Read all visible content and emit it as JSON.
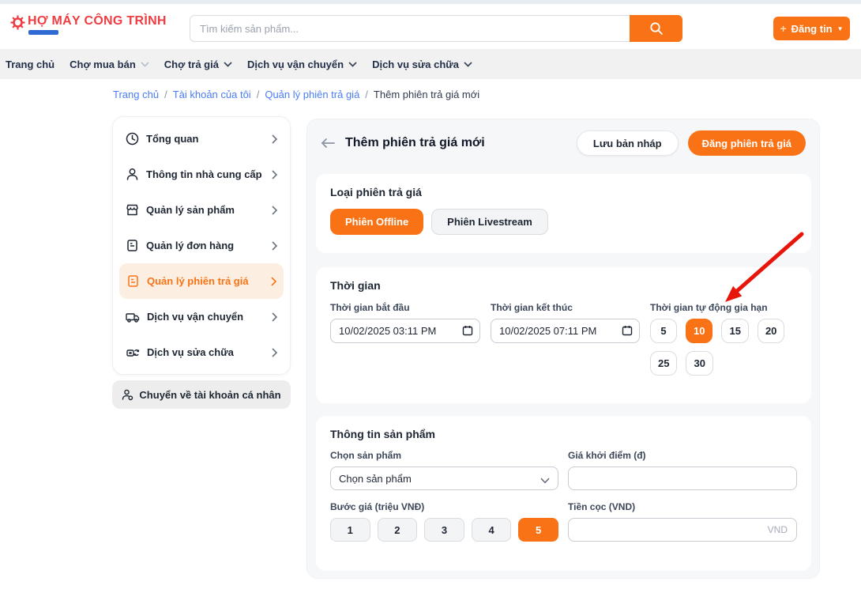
{
  "accent_color": "#f97316",
  "header": {
    "logo_text": "HỢ MÁY CÔNG TRÌNH",
    "search_placeholder": "Tìm kiếm sản phẩm...",
    "post_button_label": "Đăng tin",
    "post_button_plus": "+",
    "post_button_caret": "▼"
  },
  "nav": {
    "items": [
      {
        "label": "Trang chủ"
      },
      {
        "label": "Chợ mua bán"
      },
      {
        "label": "Chợ trả giá"
      },
      {
        "label": "Dịch vụ vận chuyển"
      },
      {
        "label": "Dịch vụ sửa chữa"
      }
    ]
  },
  "breadcrumb": {
    "separator": "/",
    "links": [
      "Trang chủ",
      "Tài khoản của tôi",
      "Quản lý phiên trả giá"
    ],
    "current": "Thêm phiên trả giá mới"
  },
  "sidebar": {
    "items": [
      {
        "icon": "clock-icon",
        "label": "Tổng quan"
      },
      {
        "icon": "user-icon",
        "label": "Thông tin nhà cung cấp"
      },
      {
        "icon": "store-icon",
        "label": "Quản lý sản phẩm"
      },
      {
        "icon": "order-icon",
        "label": "Quản lý đơn hàng"
      },
      {
        "icon": "auction-icon",
        "label": "Quản lý phiên trả giá"
      },
      {
        "icon": "truck-icon",
        "label": "Dịch vụ vận chuyển"
      },
      {
        "icon": "repair-icon",
        "label": "Dịch vụ sửa chữa"
      }
    ],
    "active_item": "Quản lý phiên trả giá",
    "switch_account_label": "Chuyển về tài khoản cá nhân"
  },
  "main": {
    "title": "Thêm phiên trả giá mới",
    "draft_button": "Lưu bản nháp",
    "publish_button": "Đăng phiên trả giá",
    "session_type": {
      "title": "Loại phiên trả giá",
      "offline_option": "Phiên Offline",
      "livestream_option": "Phiên Livestream",
      "selected": "Phiên Offline"
    },
    "time": {
      "title": "Thời gian",
      "start_label": "Thời gian bắt đầu",
      "start_value": "10/02/2025 03:11 PM",
      "end_label": "Thời gian kết thúc",
      "end_value": "10/02/2025 07:11 PM",
      "extend_label": "Thời gian tự động gia hạn",
      "extend_options": [
        "5",
        "10",
        "15",
        "20",
        "25",
        "30"
      ],
      "extend_selected": "10"
    },
    "product": {
      "title": "Thông tin sản phẩm",
      "select_label": "Chọn sản phẩm",
      "select_value": "Chọn sản phẩm",
      "start_price_label": "Giá khởi điểm (đ)",
      "start_price_value": "",
      "step_label": "Bước giá (triệu VNĐ)",
      "step_options": [
        "1",
        "2",
        "3",
        "4",
        "5"
      ],
      "step_selected": "5",
      "deposit_label": "Tiền cọc (VND)",
      "deposit_suffix": "VND",
      "deposit_value": ""
    }
  }
}
